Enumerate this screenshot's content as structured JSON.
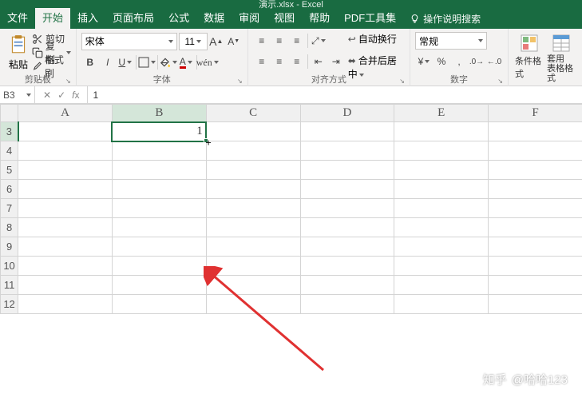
{
  "title": {
    "text": "演示.xlsx - Excel"
  },
  "tabs": {
    "items": [
      "文件",
      "开始",
      "插入",
      "页面布局",
      "公式",
      "数据",
      "审阅",
      "视图",
      "帮助",
      "PDF工具集"
    ],
    "active_index": 1,
    "help": "操作说明搜索"
  },
  "ribbon": {
    "clipboard": {
      "label": "剪贴板",
      "paste": "粘贴",
      "cut": "剪切",
      "copy": "复制",
      "painter": "格式刷"
    },
    "font": {
      "label": "字体",
      "name": "宋体",
      "size": "11"
    },
    "alignment": {
      "label": "对齐方式",
      "wrap": "自动换行",
      "merge": "合并后居中"
    },
    "number": {
      "label": "数字",
      "format": "常规"
    },
    "styles": {
      "cond": "条件格式",
      "table": "套用\n表格格式"
    }
  },
  "formula_bar": {
    "name_box": "B3",
    "fx_value": "1"
  },
  "grid": {
    "cols": [
      "A",
      "B",
      "C",
      "D",
      "E",
      "F"
    ],
    "rows": [
      "3",
      "4",
      "5",
      "6",
      "7",
      "8",
      "9",
      "10",
      "11",
      "12"
    ],
    "active_col": 1,
    "active_row": 0,
    "cell_value": "1"
  },
  "watermark": {
    "site": "知乎",
    "user": "@哈哈123"
  }
}
